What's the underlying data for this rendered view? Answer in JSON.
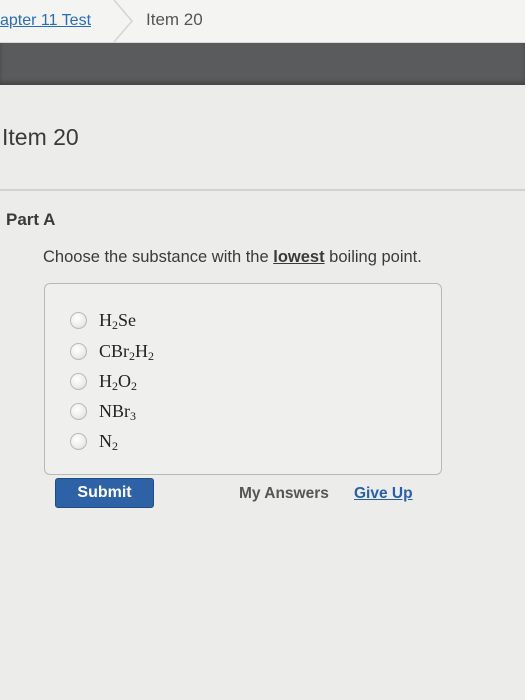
{
  "breadcrumb": {
    "link_label": "apter 11 Test",
    "current_label": "Item 20"
  },
  "item_title": "Item 20",
  "part": {
    "title": "Part A",
    "question_before": "Choose the substance with the ",
    "question_emphasis": "lowest",
    "question_after": " boiling point."
  },
  "choices": [
    {
      "base1": "H",
      "sub1": "2",
      "base2": "Se",
      "sub2": "",
      "base3": "",
      "sub3": ""
    },
    {
      "base1": "CBr",
      "sub1": "2",
      "base2": "H",
      "sub2": "2",
      "base3": "",
      "sub3": ""
    },
    {
      "base1": "H",
      "sub1": "2",
      "base2": "O",
      "sub2": "2",
      "base3": "",
      "sub3": ""
    },
    {
      "base1": "NBr",
      "sub1": "3",
      "base2": "",
      "sub2": "",
      "base3": "",
      "sub3": ""
    },
    {
      "base1": "N",
      "sub1": "2",
      "base2": "",
      "sub2": "",
      "base3": "",
      "sub3": ""
    }
  ],
  "actions": {
    "submit_label": "Submit",
    "my_answers_label": "My Answers",
    "give_up_label": "Give Up"
  },
  "colors": {
    "link": "#2a6db5",
    "submit_bg": "#2d63a6",
    "header_bar": "#5a5b5d"
  }
}
